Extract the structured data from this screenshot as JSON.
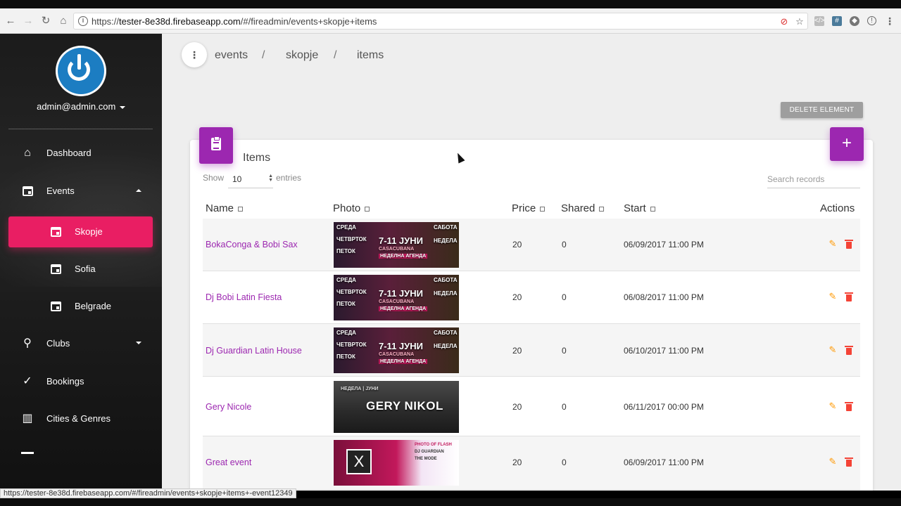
{
  "browser": {
    "url_prefix": "https://",
    "url_host": "tester-8e38d.firebaseapp.com",
    "url_path": "/#/fireadmin/events+skopje+items",
    "status_url": "https://tester-8e38d.firebaseapp.com/#/fireadmin/events+skopje+items+-event12349"
  },
  "sidebar": {
    "user": "admin@admin.com",
    "items": [
      {
        "label": "Dashboard",
        "icon": "home-icon"
      },
      {
        "label": "Events",
        "icon": "calendar-icon"
      },
      {
        "label": "Skopje",
        "icon": "calendar-icon"
      },
      {
        "label": "Sofia",
        "icon": "calendar-icon"
      },
      {
        "label": "Belgrade",
        "icon": "calendar-icon"
      },
      {
        "label": "Clubs",
        "icon": "location-pin-icon"
      },
      {
        "label": "Bookings",
        "icon": "check-icon"
      },
      {
        "label": "Cities & Genres",
        "icon": "city-icon"
      }
    ],
    "active_color": "#e91e63"
  },
  "breadcrumb": {
    "items": [
      "events",
      "skopje",
      "items"
    ],
    "separator": "/"
  },
  "toolbar": {
    "delete_label": "DELETE ELEMENT"
  },
  "table": {
    "title": "Items",
    "show_label": "Show",
    "page_size": "10",
    "entries_label": "entries",
    "search_placeholder": "Search records",
    "columns": [
      "Name",
      "Photo",
      "Price",
      "Shared",
      "Start",
      "Actions"
    ],
    "rows": [
      {
        "name": "BokaConga & Bobi Sax",
        "price": "20",
        "shared": "0",
        "start": "06/09/2017 11:00 PM",
        "photo": "casacubana"
      },
      {
        "name": "Dj Bobi Latin Fiesta",
        "price": "20",
        "shared": "0",
        "start": "06/08/2017 11:00 PM",
        "photo": "casacubana"
      },
      {
        "name": "Dj Guardian Latin House",
        "price": "20",
        "shared": "0",
        "start": "06/10/2017 11:00 PM",
        "photo": "casacubana"
      },
      {
        "name": "Gery Nicole",
        "price": "20",
        "shared": "0",
        "start": "06/11/2017 00:00 PM",
        "photo": "gerynikol"
      },
      {
        "name": "Great event",
        "price": "20",
        "shared": "0",
        "start": "06/09/2017 11:00 PM",
        "photo": "xflash"
      }
    ],
    "accent_color": "#9c27b0"
  },
  "photos": {
    "casacubana": {
      "left_1": "СРЕДА",
      "left_2": "ЧЕТВРТОК",
      "left_3": "ПЕТОК",
      "center": "7-11 ЈУНИ",
      "center_2": "CASACUBANA",
      "center_3": "НЕДЕЛНА АГЕНДА",
      "right_1": "САБОТА",
      "right_2": "НЕДЕЛА"
    },
    "gerynikol": {
      "title": "GERY NIKOL",
      "sub": "НЕДЕЛА | ЈУНИ"
    },
    "xflash": {
      "line1": "PHOTO OF FLASH",
      "line2": "DJ GUARDIAN",
      "line3": "THE MODE"
    }
  }
}
